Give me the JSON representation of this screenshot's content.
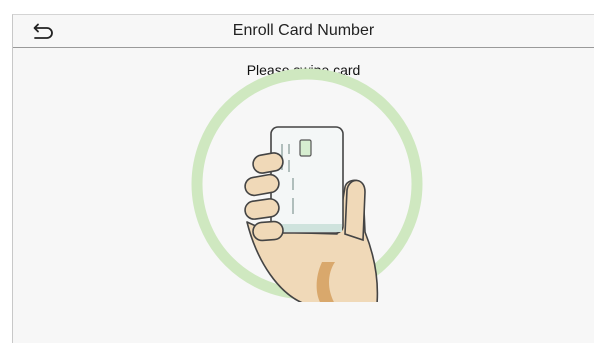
{
  "header": {
    "title": "Enroll Card Number",
    "back_icon": "return-arrow-icon"
  },
  "main": {
    "prompt": "Please swipe card",
    "illustration_icon": "hand-holding-card-icon"
  },
  "colors": {
    "ring": "#cfe8c0",
    "chip": "#d6eed0",
    "skin": "#f0d9b8",
    "skin_shadow": "#d9b88f",
    "cuff": "#d9a86c",
    "card": "#f4f7f7",
    "card_stripe": "#cfe3dd"
  }
}
